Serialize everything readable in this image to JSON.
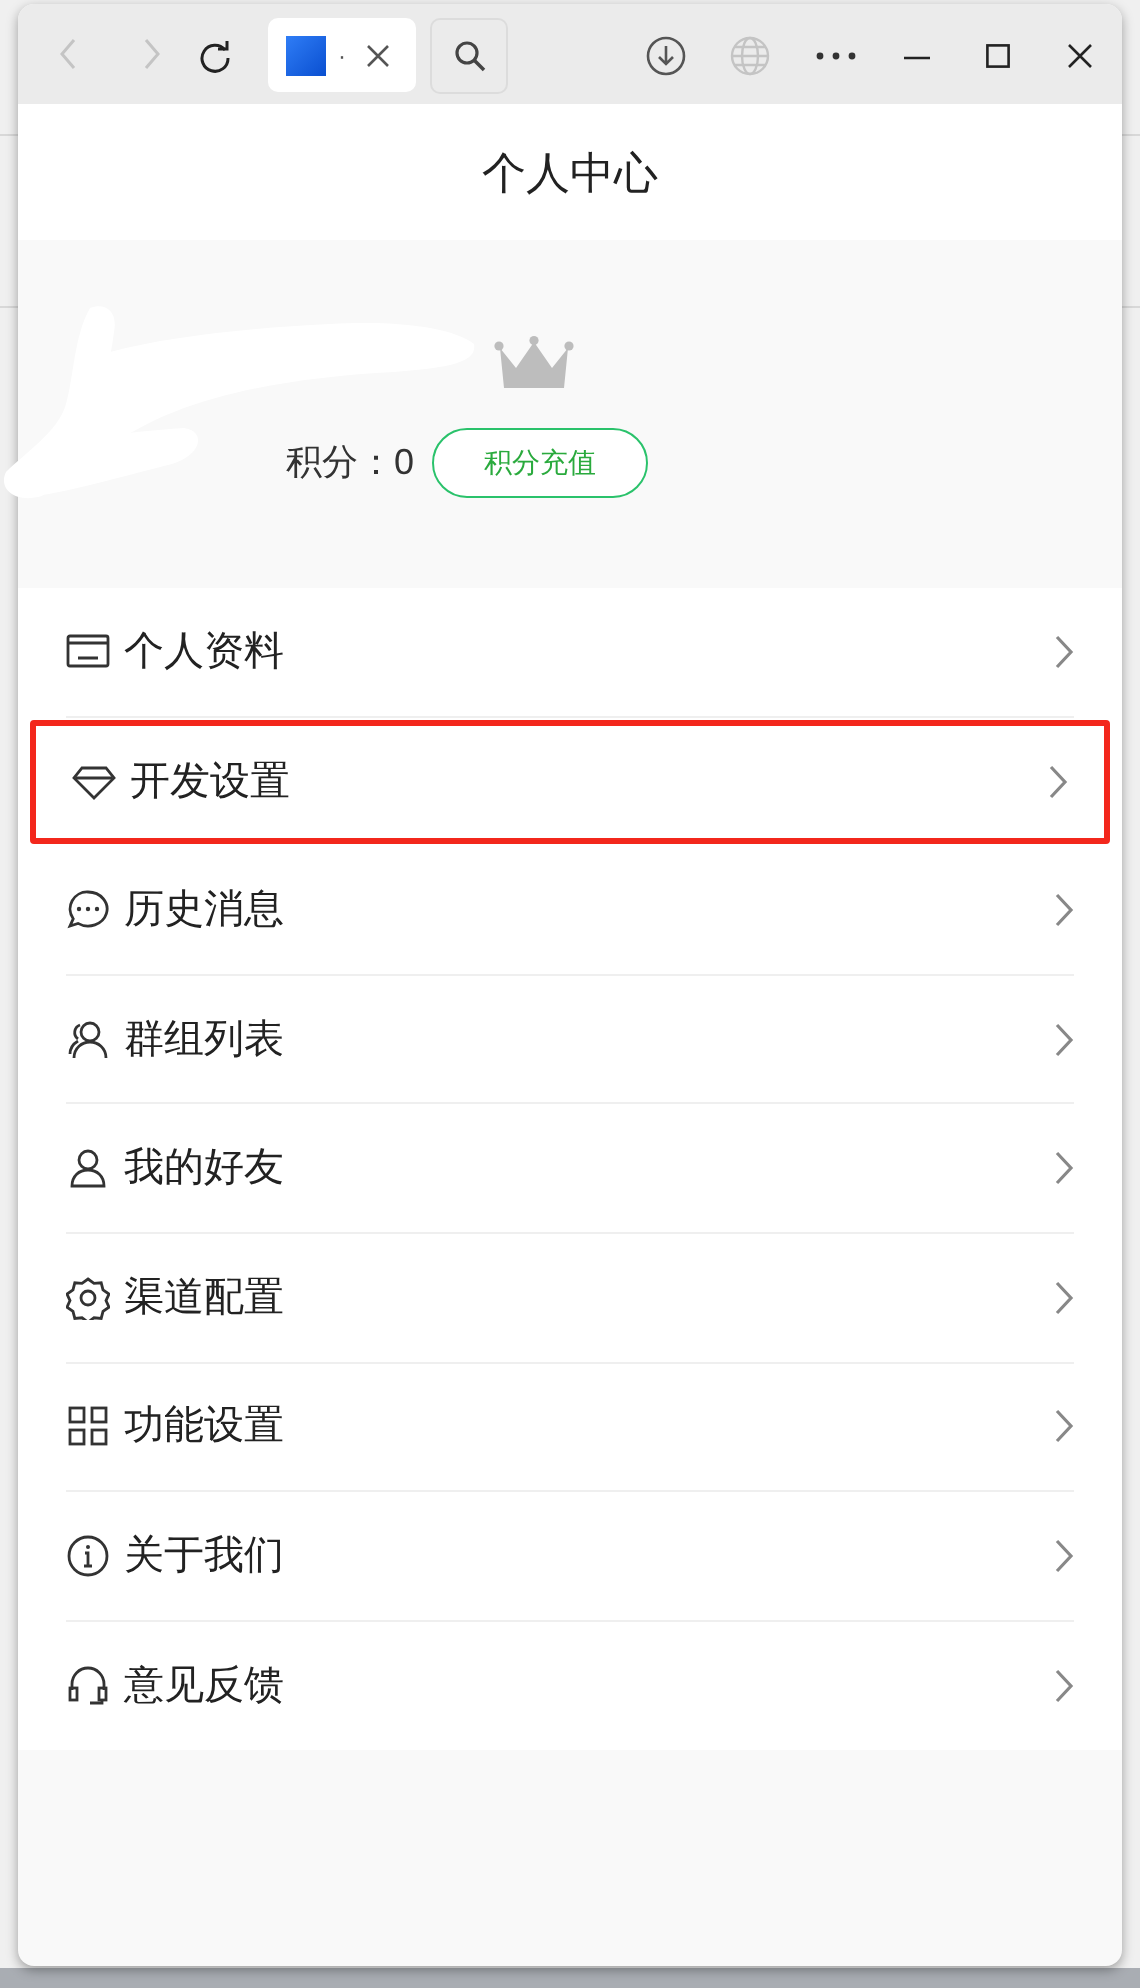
{
  "browser": {
    "tab_title": "·"
  },
  "page": {
    "title": "个人中心"
  },
  "profile": {
    "points_label": "积分：",
    "points_value": "0",
    "recharge_button": "积分充值"
  },
  "menu": [
    {
      "label": "个人资料",
      "kind": "card",
      "highlighted": false
    },
    {
      "label": "开发设置",
      "kind": "diamond",
      "highlighted": true
    },
    {
      "label": "历史消息",
      "kind": "chat",
      "highlighted": false
    },
    {
      "label": "群组列表",
      "kind": "group",
      "highlighted": false
    },
    {
      "label": "我的好友",
      "kind": "user",
      "highlighted": false
    },
    {
      "label": "渠道配置",
      "kind": "gear",
      "highlighted": false
    },
    {
      "label": "功能设置",
      "kind": "grid",
      "highlighted": false
    },
    {
      "label": "关于我们",
      "kind": "info",
      "highlighted": false
    },
    {
      "label": "意见反馈",
      "kind": "headset",
      "highlighted": false
    }
  ]
}
